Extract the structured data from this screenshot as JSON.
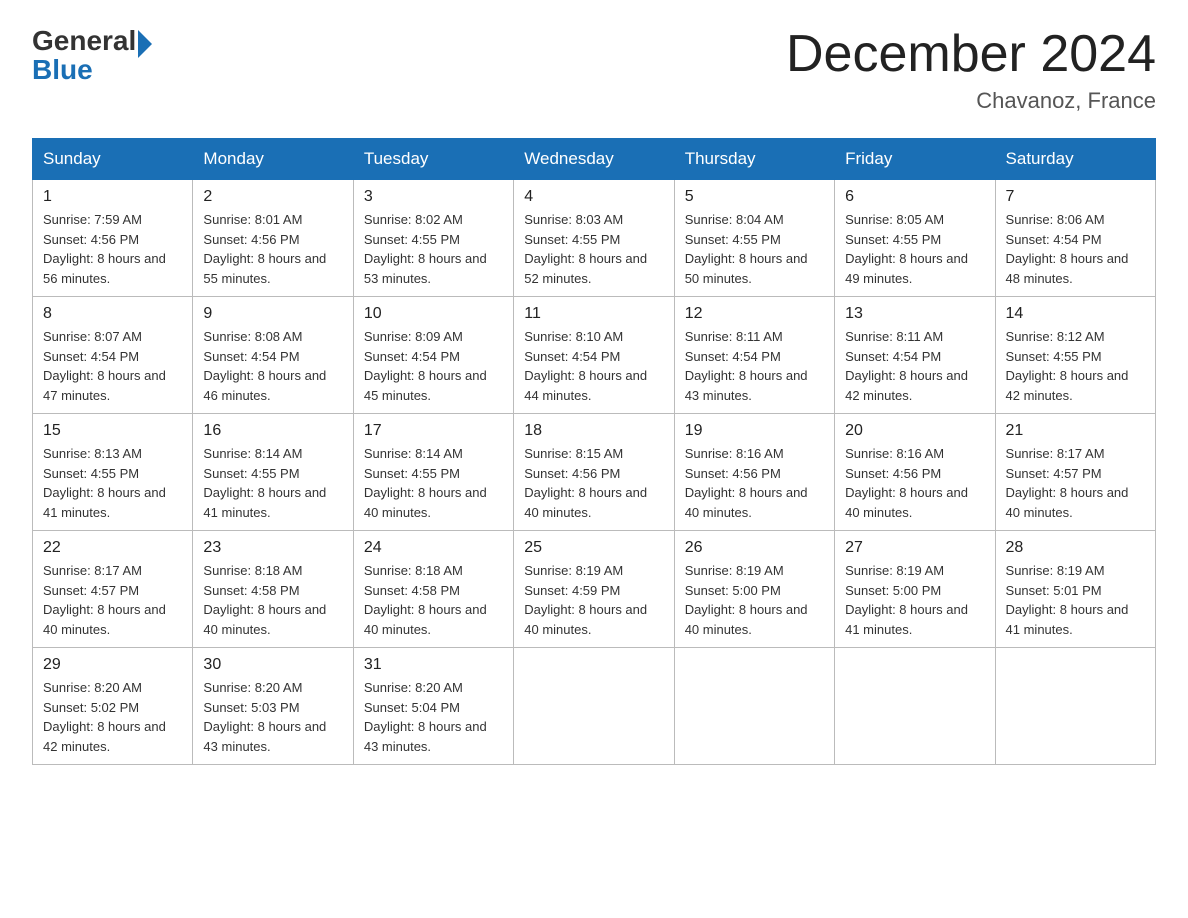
{
  "header": {
    "logo_general": "General",
    "logo_blue": "Blue",
    "month_title": "December 2024",
    "location": "Chavanoz, France"
  },
  "days_of_week": [
    "Sunday",
    "Monday",
    "Tuesday",
    "Wednesday",
    "Thursday",
    "Friday",
    "Saturday"
  ],
  "weeks": [
    [
      {
        "num": "1",
        "sunrise": "7:59 AM",
        "sunset": "4:56 PM",
        "daylight": "8 hours and 56 minutes."
      },
      {
        "num": "2",
        "sunrise": "8:01 AM",
        "sunset": "4:56 PM",
        "daylight": "8 hours and 55 minutes."
      },
      {
        "num": "3",
        "sunrise": "8:02 AM",
        "sunset": "4:55 PM",
        "daylight": "8 hours and 53 minutes."
      },
      {
        "num": "4",
        "sunrise": "8:03 AM",
        "sunset": "4:55 PM",
        "daylight": "8 hours and 52 minutes."
      },
      {
        "num": "5",
        "sunrise": "8:04 AM",
        "sunset": "4:55 PM",
        "daylight": "8 hours and 50 minutes."
      },
      {
        "num": "6",
        "sunrise": "8:05 AM",
        "sunset": "4:55 PM",
        "daylight": "8 hours and 49 minutes."
      },
      {
        "num": "7",
        "sunrise": "8:06 AM",
        "sunset": "4:54 PM",
        "daylight": "8 hours and 48 minutes."
      }
    ],
    [
      {
        "num": "8",
        "sunrise": "8:07 AM",
        "sunset": "4:54 PM",
        "daylight": "8 hours and 47 minutes."
      },
      {
        "num": "9",
        "sunrise": "8:08 AM",
        "sunset": "4:54 PM",
        "daylight": "8 hours and 46 minutes."
      },
      {
        "num": "10",
        "sunrise": "8:09 AM",
        "sunset": "4:54 PM",
        "daylight": "8 hours and 45 minutes."
      },
      {
        "num": "11",
        "sunrise": "8:10 AM",
        "sunset": "4:54 PM",
        "daylight": "8 hours and 44 minutes."
      },
      {
        "num": "12",
        "sunrise": "8:11 AM",
        "sunset": "4:54 PM",
        "daylight": "8 hours and 43 minutes."
      },
      {
        "num": "13",
        "sunrise": "8:11 AM",
        "sunset": "4:54 PM",
        "daylight": "8 hours and 42 minutes."
      },
      {
        "num": "14",
        "sunrise": "8:12 AM",
        "sunset": "4:55 PM",
        "daylight": "8 hours and 42 minutes."
      }
    ],
    [
      {
        "num": "15",
        "sunrise": "8:13 AM",
        "sunset": "4:55 PM",
        "daylight": "8 hours and 41 minutes."
      },
      {
        "num": "16",
        "sunrise": "8:14 AM",
        "sunset": "4:55 PM",
        "daylight": "8 hours and 41 minutes."
      },
      {
        "num": "17",
        "sunrise": "8:14 AM",
        "sunset": "4:55 PM",
        "daylight": "8 hours and 40 minutes."
      },
      {
        "num": "18",
        "sunrise": "8:15 AM",
        "sunset": "4:56 PM",
        "daylight": "8 hours and 40 minutes."
      },
      {
        "num": "19",
        "sunrise": "8:16 AM",
        "sunset": "4:56 PM",
        "daylight": "8 hours and 40 minutes."
      },
      {
        "num": "20",
        "sunrise": "8:16 AM",
        "sunset": "4:56 PM",
        "daylight": "8 hours and 40 minutes."
      },
      {
        "num": "21",
        "sunrise": "8:17 AM",
        "sunset": "4:57 PM",
        "daylight": "8 hours and 40 minutes."
      }
    ],
    [
      {
        "num": "22",
        "sunrise": "8:17 AM",
        "sunset": "4:57 PM",
        "daylight": "8 hours and 40 minutes."
      },
      {
        "num": "23",
        "sunrise": "8:18 AM",
        "sunset": "4:58 PM",
        "daylight": "8 hours and 40 minutes."
      },
      {
        "num": "24",
        "sunrise": "8:18 AM",
        "sunset": "4:58 PM",
        "daylight": "8 hours and 40 minutes."
      },
      {
        "num": "25",
        "sunrise": "8:19 AM",
        "sunset": "4:59 PM",
        "daylight": "8 hours and 40 minutes."
      },
      {
        "num": "26",
        "sunrise": "8:19 AM",
        "sunset": "5:00 PM",
        "daylight": "8 hours and 40 minutes."
      },
      {
        "num": "27",
        "sunrise": "8:19 AM",
        "sunset": "5:00 PM",
        "daylight": "8 hours and 41 minutes."
      },
      {
        "num": "28",
        "sunrise": "8:19 AM",
        "sunset": "5:01 PM",
        "daylight": "8 hours and 41 minutes."
      }
    ],
    [
      {
        "num": "29",
        "sunrise": "8:20 AM",
        "sunset": "5:02 PM",
        "daylight": "8 hours and 42 minutes."
      },
      {
        "num": "30",
        "sunrise": "8:20 AM",
        "sunset": "5:03 PM",
        "daylight": "8 hours and 43 minutes."
      },
      {
        "num": "31",
        "sunrise": "8:20 AM",
        "sunset": "5:04 PM",
        "daylight": "8 hours and 43 minutes."
      },
      null,
      null,
      null,
      null
    ]
  ]
}
